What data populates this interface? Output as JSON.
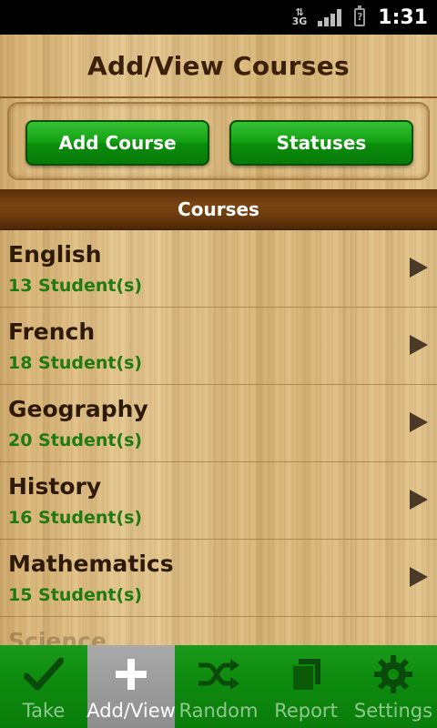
{
  "status_bar": {
    "network": "3G",
    "time": "1:31",
    "battery_mark": "?"
  },
  "title": "Add/View Courses",
  "buttons": {
    "add_course": "Add Course",
    "statuses": "Statuses"
  },
  "section_header": "Courses",
  "courses": [
    {
      "name": "English",
      "students": "13 Student(s)"
    },
    {
      "name": "French",
      "students": "18 Student(s)"
    },
    {
      "name": "Geography",
      "students": "20 Student(s)"
    },
    {
      "name": "History",
      "students": "16 Student(s)"
    },
    {
      "name": "Mathematics",
      "students": "15 Student(s)"
    },
    {
      "name": "Science",
      "students": ""
    }
  ],
  "tabs": [
    {
      "label": "Take",
      "icon": "checkmark-icon",
      "active": false
    },
    {
      "label": "Add/View",
      "icon": "plus-icon",
      "active": true
    },
    {
      "label": "Random",
      "icon": "shuffle-icon",
      "active": false
    },
    {
      "label": "Report",
      "icon": "report-icon",
      "active": false
    },
    {
      "label": "Settings",
      "icon": "gear-icon",
      "active": false
    }
  ],
  "colors": {
    "accent_green": "#14a314",
    "header_brown": "#6a3a0e",
    "student_count_green": "#1f7a12"
  }
}
